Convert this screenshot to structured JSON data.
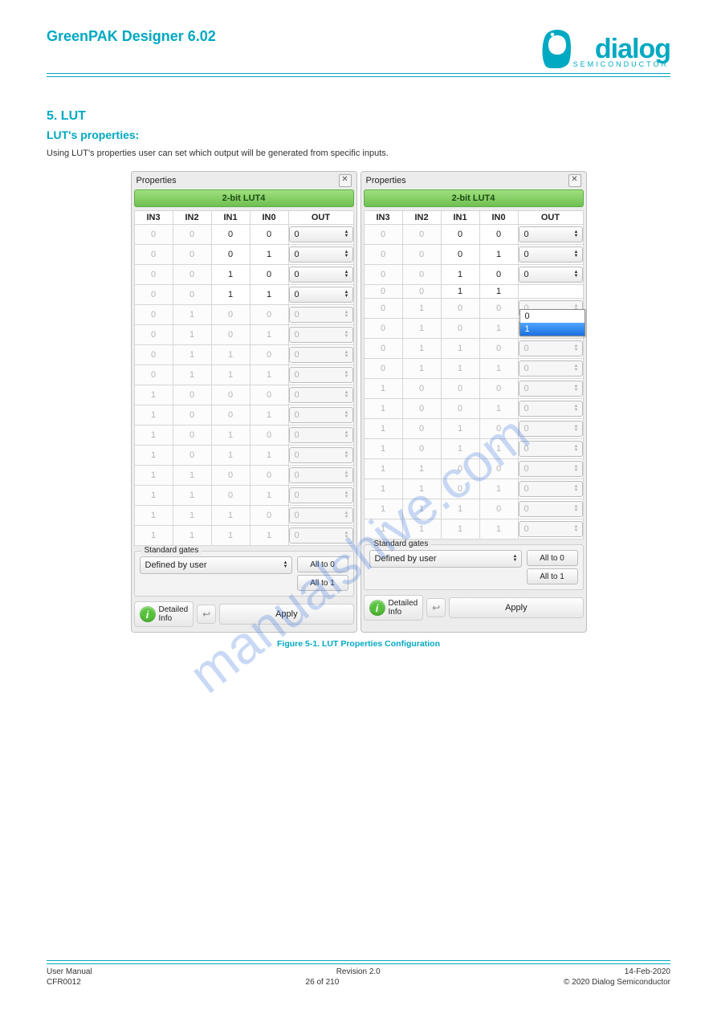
{
  "brand": {
    "name": "dialog",
    "sub": "SEMICONDUCTOR"
  },
  "doc": {
    "title": "GreenPAK Designer 6.02"
  },
  "section": {
    "number": "5. LUT",
    "heading": "LUT's properties:",
    "body": "Using LUT's properties user can set which output will be generated from specific inputs."
  },
  "panel": {
    "header": "Properties",
    "title": "2-bit LUT4",
    "columns": [
      "IN3",
      "IN2",
      "IN1",
      "IN0",
      "OUT"
    ],
    "rows": [
      {
        "in": [
          0,
          0,
          0,
          0
        ],
        "out": "0",
        "dim": [
          true,
          true,
          false,
          false
        ],
        "enabled": true
      },
      {
        "in": [
          0,
          0,
          0,
          1
        ],
        "out": "0",
        "dim": [
          true,
          true,
          false,
          false
        ],
        "enabled": true
      },
      {
        "in": [
          0,
          0,
          1,
          0
        ],
        "out": "0",
        "dim": [
          true,
          true,
          false,
          false
        ],
        "enabled": true
      },
      {
        "in": [
          0,
          0,
          1,
          1
        ],
        "out": "0",
        "dim": [
          true,
          true,
          false,
          false
        ],
        "enabled": true
      },
      {
        "in": [
          0,
          1,
          0,
          0
        ],
        "out": "0",
        "dim": [
          true,
          true,
          true,
          true
        ],
        "enabled": false
      },
      {
        "in": [
          0,
          1,
          0,
          1
        ],
        "out": "0",
        "dim": [
          true,
          true,
          true,
          true
        ],
        "enabled": false
      },
      {
        "in": [
          0,
          1,
          1,
          0
        ],
        "out": "0",
        "dim": [
          true,
          true,
          true,
          true
        ],
        "enabled": false
      },
      {
        "in": [
          0,
          1,
          1,
          1
        ],
        "out": "0",
        "dim": [
          true,
          true,
          true,
          true
        ],
        "enabled": false
      },
      {
        "in": [
          1,
          0,
          0,
          0
        ],
        "out": "0",
        "dim": [
          true,
          true,
          true,
          true
        ],
        "enabled": false
      },
      {
        "in": [
          1,
          0,
          0,
          1
        ],
        "out": "0",
        "dim": [
          true,
          true,
          true,
          true
        ],
        "enabled": false
      },
      {
        "in": [
          1,
          0,
          1,
          0
        ],
        "out": "0",
        "dim": [
          true,
          true,
          true,
          true
        ],
        "enabled": false
      },
      {
        "in": [
          1,
          0,
          1,
          1
        ],
        "out": "0",
        "dim": [
          true,
          true,
          true,
          true
        ],
        "enabled": false
      },
      {
        "in": [
          1,
          1,
          0,
          0
        ],
        "out": "0",
        "dim": [
          true,
          true,
          true,
          true
        ],
        "enabled": false
      },
      {
        "in": [
          1,
          1,
          0,
          1
        ],
        "out": "0",
        "dim": [
          true,
          true,
          true,
          true
        ],
        "enabled": false
      },
      {
        "in": [
          1,
          1,
          1,
          0
        ],
        "out": "0",
        "dim": [
          true,
          true,
          true,
          true
        ],
        "enabled": false
      },
      {
        "in": [
          1,
          1,
          1,
          1
        ],
        "out": "0",
        "dim": [
          true,
          true,
          true,
          true
        ],
        "enabled": false
      }
    ],
    "std_gates_label": "Standard gates",
    "combo_value": "Defined by user",
    "btn_all0": "All to 0",
    "btn_all1": "All to 1",
    "detailed": "Detailed",
    "info": "Info",
    "apply": "Apply"
  },
  "dropdown": {
    "opt0": "0",
    "opt1": "1"
  },
  "figure_caption": "Figure 5-1. LUT Properties Configuration",
  "footer": {
    "left": "User Manual",
    "rev_label": "Revision 2.0",
    "date": "14-Feb-2020",
    "conf": "CFR0012",
    "page": "26 of 210",
    "copy": "© 2020 Dialog Semiconductor"
  },
  "watermark": "manualshive.com"
}
